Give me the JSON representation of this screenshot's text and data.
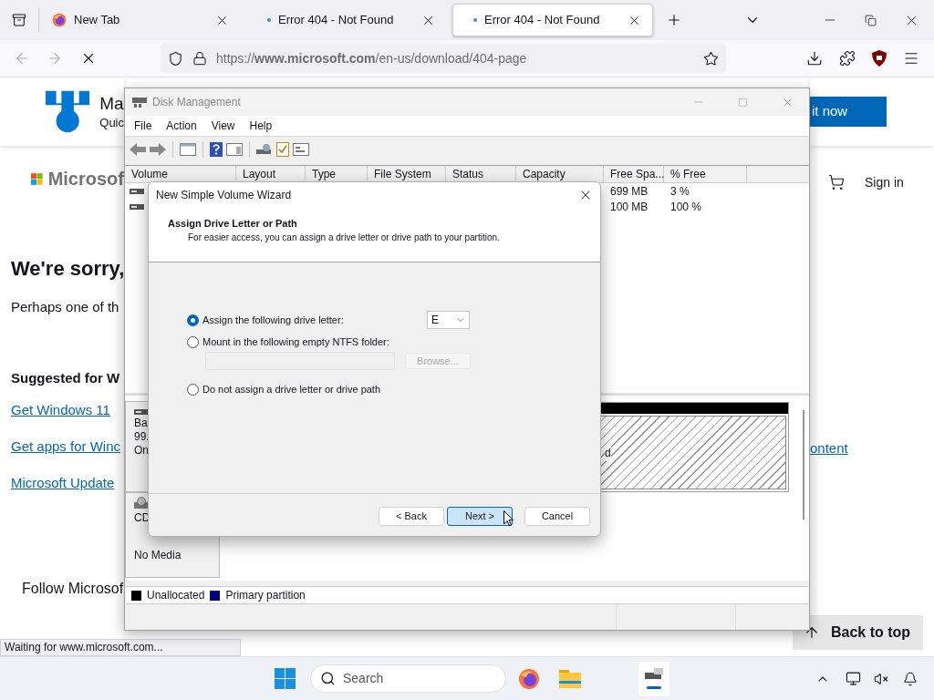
{
  "browser": {
    "tabs": [
      {
        "title": "New Tab",
        "selected": false,
        "kind": "firefox"
      },
      {
        "title": "Error 404 - Not Found",
        "selected": false,
        "kind": "loading"
      },
      {
        "title": "Error 404 - Not Found",
        "selected": true,
        "kind": "loading"
      }
    ],
    "url": "https://**www.microsoft.com**/en-us/download/404-page",
    "status": "Waiting for www.microsoft.com..."
  },
  "page": {
    "header_title": "Ma",
    "header_subtitle": "Quic",
    "header_button": "it now",
    "brand": "Microsof",
    "sign_in": "Sign in",
    "heading": "We're sorry,",
    "message": "Perhaps one of th",
    "suggested_heading": "Suggested for W",
    "links": [
      "Get Windows 11",
      "Get apps for Winc",
      "Microsoft Update"
    ],
    "right_link": "ontent",
    "follow": "Follow Microsof",
    "back_to_top": "Back to top"
  },
  "disk_management": {
    "title": "Disk Management",
    "menu": [
      "File",
      "Action",
      "View",
      "Help"
    ],
    "columns": [
      "Volume",
      "Layout",
      "Type",
      "File System",
      "Status",
      "Capacity",
      "Free Spa...",
      "% Free"
    ],
    "rows": [
      {
        "free_space": "699 MB",
        "percent_free": "3 %"
      },
      {
        "free_space": "100 MB",
        "percent_free": "100 %"
      }
    ],
    "disks": [
      {
        "kind": "disk",
        "label_lines": [
          "Ba",
          "99.",
          "On"
        ],
        "partition_text": "d"
      },
      {
        "kind": "cdrom",
        "label_lines": [
          "CD",
          "No Media"
        ]
      }
    ],
    "legend": [
      {
        "label": "Unallocated",
        "color": "#000000"
      },
      {
        "label": "Primary partition",
        "color": "#000080"
      }
    ]
  },
  "wizard": {
    "title": "New Simple Volume Wizard",
    "heading": "Assign Drive Letter or Path",
    "description": "For easier access, you can assign a drive letter or drive path to your partition.",
    "options": [
      {
        "label": "Assign the following drive letter:",
        "selected": true
      },
      {
        "label": "Mount in the following empty NTFS folder:",
        "selected": false
      },
      {
        "label": "Do not assign a drive letter or drive path",
        "selected": false
      }
    ],
    "drive_letter": "E",
    "browse_button": {
      "label": "Browse...",
      "disabled": true
    },
    "buttons": [
      {
        "label": "< Back",
        "focused": false
      },
      {
        "label": "Next >",
        "focused": true
      },
      {
        "label": "Cancel",
        "focused": false
      }
    ]
  },
  "taskbar": {
    "search_label": "Search"
  }
}
